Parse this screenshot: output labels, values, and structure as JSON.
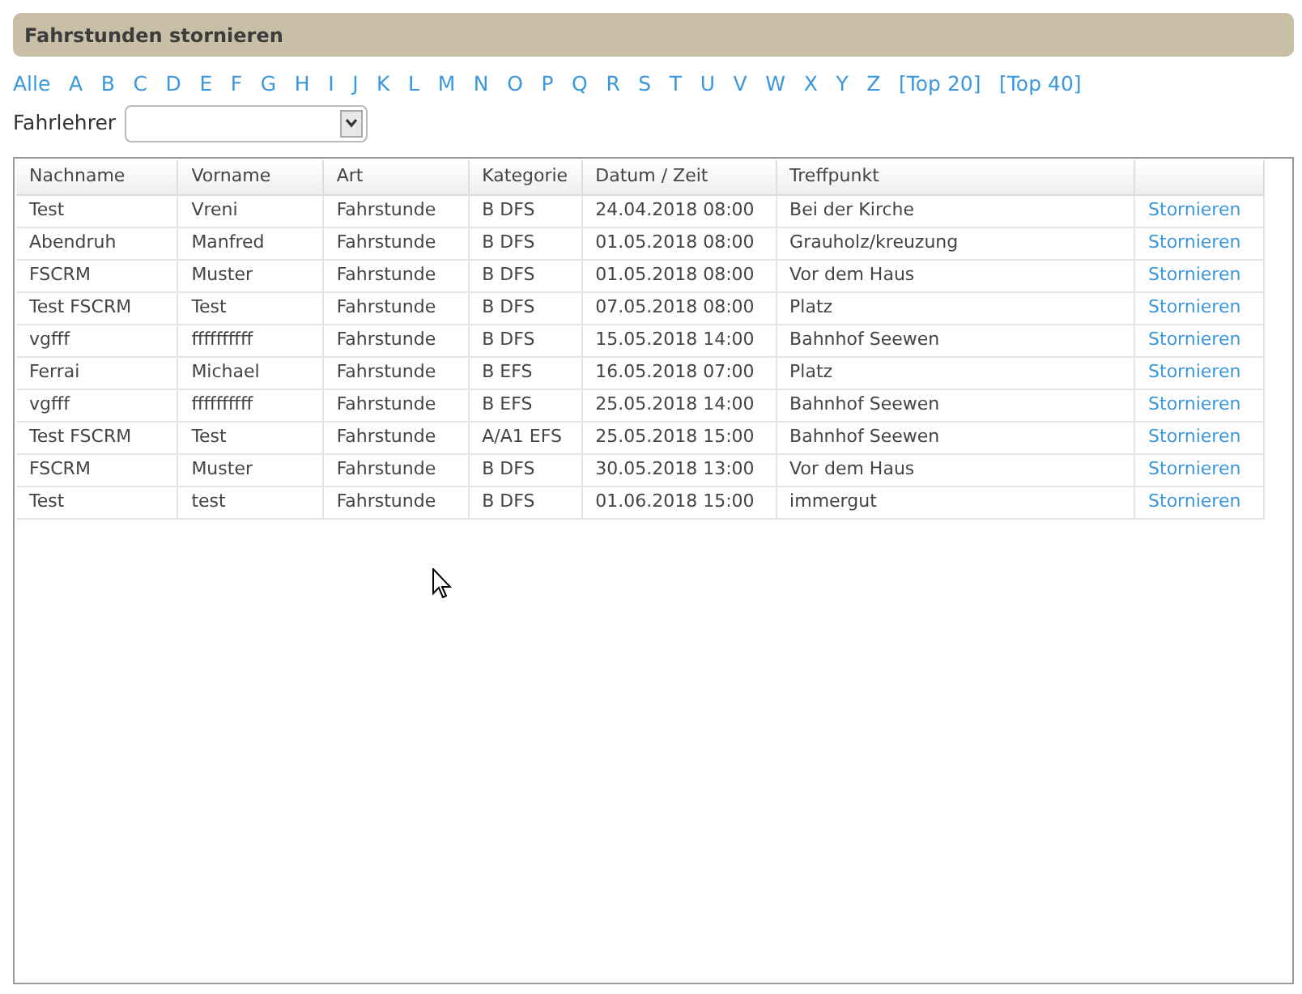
{
  "title": "Fahrstunden stornieren",
  "letters": [
    "Alle",
    "A",
    "B",
    "C",
    "D",
    "E",
    "F",
    "G",
    "H",
    "I",
    "J",
    "K",
    "L",
    "M",
    "N",
    "O",
    "P",
    "Q",
    "R",
    "S",
    "T",
    "U",
    "V",
    "W",
    "X",
    "Y",
    "Z",
    "[Top 20]",
    "[Top 40]"
  ],
  "filter": {
    "label": "Fahrlehrer"
  },
  "table": {
    "columns": [
      "Nachname",
      "Vorname",
      "Art",
      "Kategorie",
      "Datum / Zeit",
      "Treffpunkt"
    ],
    "rows": [
      {
        "cells": [
          "Test",
          "Vreni",
          "Fahrstunde",
          "B DFS",
          "24.04.2018 08:00",
          "Bei der Kirche"
        ],
        "action": "Stornieren"
      },
      {
        "cells": [
          "Abendruh",
          "Manfred",
          "Fahrstunde",
          "B DFS",
          "01.05.2018 08:00",
          "Grauholz/kreuzung"
        ],
        "action": "Stornieren"
      },
      {
        "cells": [
          "FSCRM",
          "Muster",
          "Fahrstunde",
          "B DFS",
          "01.05.2018 08:00",
          "Vor dem Haus"
        ],
        "action": "Stornieren"
      },
      {
        "cells": [
          "Test FSCRM",
          "Test",
          "Fahrstunde",
          "B DFS",
          "07.05.2018 08:00",
          "Platz"
        ],
        "action": "Stornieren"
      },
      {
        "cells": [
          "vgfff",
          "ffffffffff",
          "Fahrstunde",
          "B DFS",
          "15.05.2018 14:00",
          "Bahnhof Seewen"
        ],
        "action": "Stornieren"
      },
      {
        "cells": [
          "Ferrai",
          "Michael",
          "Fahrstunde",
          "B EFS",
          "16.05.2018 07:00",
          "Platz"
        ],
        "action": "Stornieren"
      },
      {
        "cells": [
          "vgfff",
          "ffffffffff",
          "Fahrstunde",
          "B EFS",
          "25.05.2018 14:00",
          "Bahnhof Seewen"
        ],
        "action": "Stornieren"
      },
      {
        "cells": [
          "Test FSCRM",
          "Test",
          "Fahrstunde",
          "A/A1 EFS",
          "25.05.2018 15:00",
          "Bahnhof Seewen"
        ],
        "action": "Stornieren"
      },
      {
        "cells": [
          "FSCRM",
          "Muster",
          "Fahrstunde",
          "B DFS",
          "30.05.2018 13:00",
          "Vor dem Haus"
        ],
        "action": "Stornieren"
      },
      {
        "cells": [
          "Test",
          "test",
          "Fahrstunde",
          "B DFS",
          "01.06.2018 15:00",
          "immergut"
        ],
        "action": "Stornieren"
      }
    ]
  }
}
